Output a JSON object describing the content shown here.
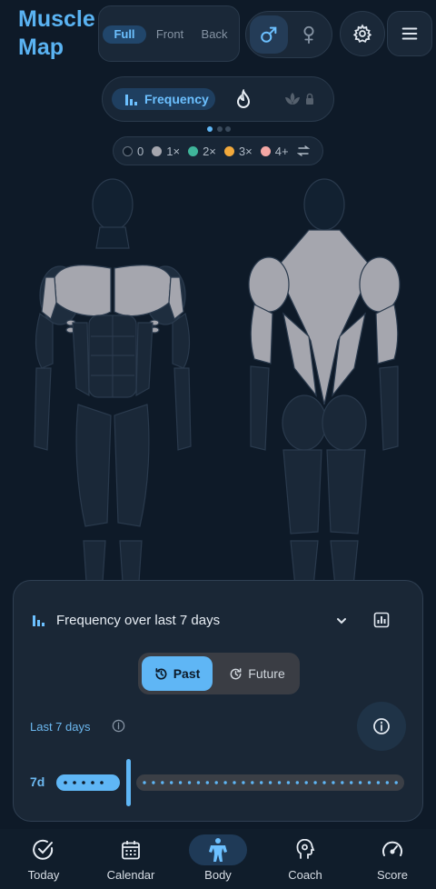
{
  "app": {
    "title": "Muscle Map"
  },
  "view_modes": {
    "full": "Full",
    "front": "Front",
    "back": "Back",
    "selected": "Full"
  },
  "gender": {
    "selected": "male",
    "male_icon": "male-icon",
    "female_icon": "female-icon"
  },
  "header_icons": {
    "settings": "gear-icon",
    "menu": "menu-icon"
  },
  "mode": {
    "label": "Frequency",
    "icons": [
      "bar-chart-icon",
      "flame-icon",
      "lotus-lock-icon"
    ],
    "page_count": 3,
    "page_index": 0
  },
  "legend": {
    "items": [
      {
        "label": "0",
        "color": "#0e1a28"
      },
      {
        "label": "1×",
        "color": "#a5a6ae"
      },
      {
        "label": "2×",
        "color": "#3fb59a"
      },
      {
        "label": "3×",
        "color": "#f2a93b"
      },
      {
        "label": "4+",
        "color": "#f4a7a4"
      }
    ],
    "swap_icon": "swap-arrows-icon"
  },
  "panel": {
    "title": "Frequency over last 7 days",
    "tabs": {
      "past": "Past",
      "future": "Future",
      "selected": "Past"
    },
    "range_label": "Last 7 days",
    "slider": {
      "label": "7d",
      "selected_days": 7
    }
  },
  "nav": {
    "items": [
      {
        "label": "Today",
        "icon": "check-circle-icon"
      },
      {
        "label": "Calendar",
        "icon": "calendar-icon"
      },
      {
        "label": "Body",
        "icon": "body-icon"
      },
      {
        "label": "Coach",
        "icon": "brain-head-icon"
      },
      {
        "label": "Score",
        "icon": "gauge-icon"
      }
    ],
    "active": "Body"
  },
  "colors": {
    "accent": "#5fb6f5",
    "background": "#0e1a28",
    "muscle_trained": "#a5a6ae",
    "muscle_idle": "#1d2b3b"
  }
}
